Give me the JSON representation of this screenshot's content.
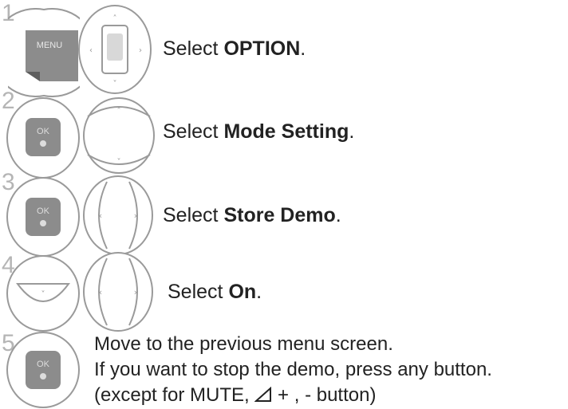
{
  "steps": [
    {
      "number": "1",
      "prefix": "Select ",
      "bold": "OPTION",
      "suffix": ".",
      "key_label": "MENU"
    },
    {
      "number": "2",
      "prefix": "Select ",
      "bold": "Mode Setting",
      "suffix": "."
    },
    {
      "number": "3",
      "prefix": "Select ",
      "bold": "Store Demo",
      "suffix": "."
    },
    {
      "number": "4",
      "prefix": "Select ",
      "bold": "On",
      "suffix": "."
    },
    {
      "number": "5",
      "lines": [
        "Move to the previous menu screen.",
        "If you want to stop the demo, press any button."
      ],
      "line3_prefix": "(except for MUTE, ",
      "line3_plus": " + , - ",
      "line3_suffix": "button)"
    }
  ]
}
